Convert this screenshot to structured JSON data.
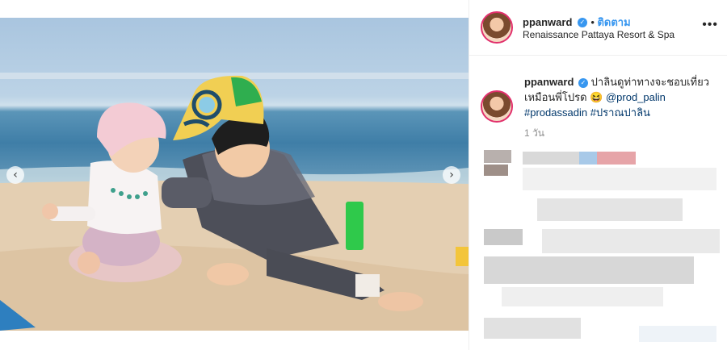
{
  "post": {
    "username": "ppanward",
    "verified_glyph": "✓",
    "follow_label": "ติดตาม",
    "location": "Renaissance Pattaya Resort & Spa",
    "more_label": "•••"
  },
  "caption": {
    "username": "ppanward",
    "text": "ปาลินดูท่าทางจะชอบเที่ยวเหมือนพี่โปรด",
    "emoji": "😆",
    "mention": "@prod_palin",
    "hashtags": [
      "#prodassadin",
      "#ปราณปาลิน"
    ],
    "time": "1 วัน"
  },
  "carousel": {
    "prev_glyph": "‹",
    "next_glyph": "›",
    "dot_count": 4,
    "active_dot": 2
  },
  "colors": {
    "link": "#00376b",
    "accent": "#3897f0",
    "story_ring": "#e1306c"
  },
  "icons": [
    "verified-badge-icon",
    "more-options-icon",
    "chevron-left-icon",
    "chevron-right-icon"
  ]
}
